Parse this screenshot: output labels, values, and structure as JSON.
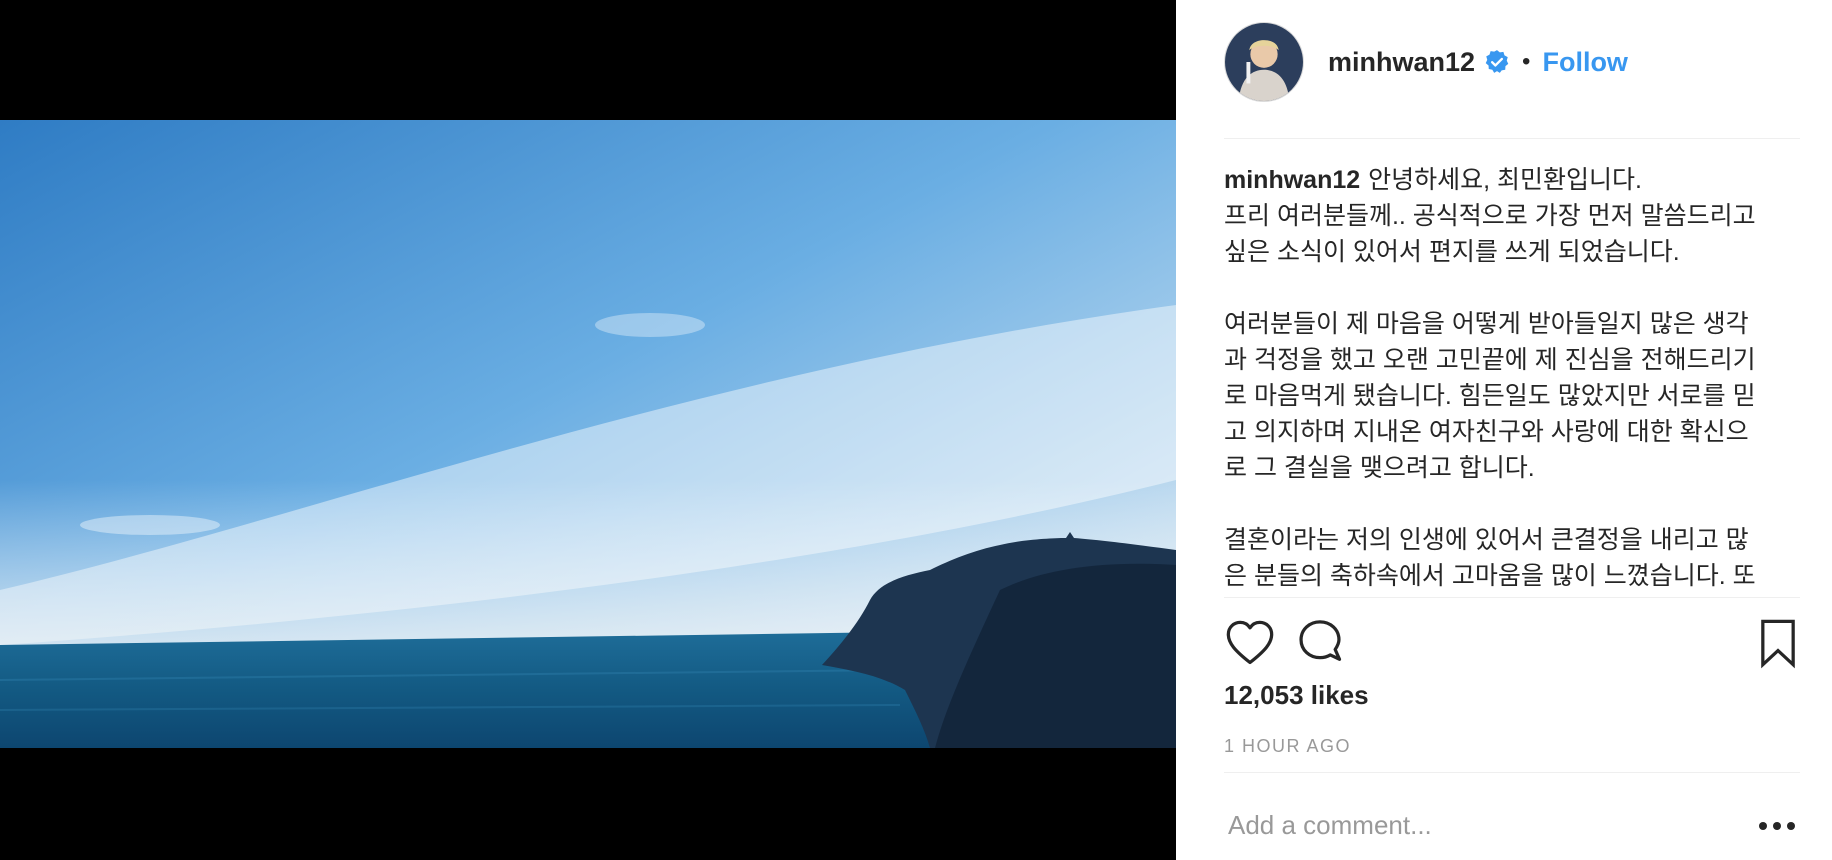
{
  "post": {
    "username": "minhwan12",
    "follow_label": "Follow",
    "separator": "•",
    "caption_username": "minhwan12",
    "caption_text": "안녕하세요, 최민환입니다.\n프리 여러분들께.. 공식적으로 가장 먼저 말씀드리고\n싶은 소식이 있어서 편지를 쓰게 되었습니다.\n\n여러분들이 제 마음을 어떻게 받아들일지 많은 생각\n과 걱정을 했고 오랜 고민끝에 제 진심을 전해드리기\n로 마음먹게 됐습니다. 힘든일도 많았지만 서로를 믿\n고 의지하며 지내온 여자친구와 사랑에 대한 확신으\n로 그 결실을 맺으려고 합니다.\n\n결혼이라는 저의 인생에 있어서 큰결정을 내리고 많\n은 분들의 축하속에서 고마움을 많이 느꼈습니다. 또",
    "likes": "12,053 likes",
    "timestamp": "1 HOUR AGO",
    "comment_placeholder": "Add a comment..."
  },
  "icons": {
    "verified": "verified-badge-icon",
    "like": "heart-icon",
    "comment": "comment-bubble-icon",
    "save": "bookmark-icon",
    "more": "more-options-icon"
  },
  "colors": {
    "link_blue": "#3897f0",
    "verified_blue": "#3897f0",
    "meta_gray": "#999999",
    "text": "#262626"
  }
}
